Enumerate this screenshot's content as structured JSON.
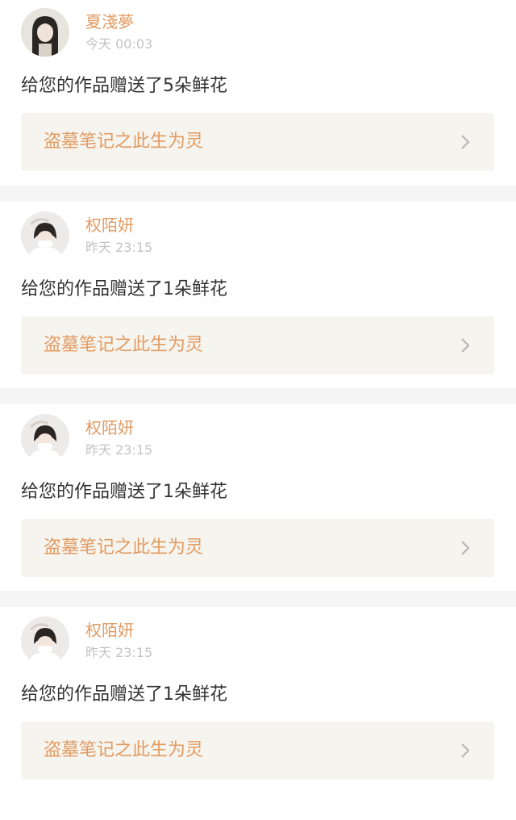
{
  "notifications": [
    {
      "user_name": "夏淺夢",
      "time": "今天 00:03",
      "message": "给您的作品赠送了5朵鲜花",
      "work_title": "盗墓笔记之此生为灵",
      "avatar_icon": "user-avatar-long-hair"
    },
    {
      "user_name": "权陌妍",
      "time": "昨天 23:15",
      "message": "给您的作品赠送了1朵鲜花",
      "work_title": "盗墓笔记之此生为灵",
      "avatar_icon": "user-avatar-masked-girl"
    },
    {
      "user_name": "权陌妍",
      "time": "昨天 23:15",
      "message": "给您的作品赠送了1朵鲜花",
      "work_title": "盗墓笔记之此生为灵",
      "avatar_icon": "user-avatar-masked-girl"
    },
    {
      "user_name": "权陌妍",
      "time": "昨天 23:15",
      "message": "给您的作品赠送了1朵鲜花",
      "work_title": "盗墓笔记之此生为灵",
      "avatar_icon": "user-avatar-masked-girl"
    }
  ],
  "colors": {
    "accent": "#e29b62",
    "time": "#c3c3c3",
    "text": "#333333",
    "link_bg": "#f5f4ee",
    "divider": "#f6f5f5"
  }
}
